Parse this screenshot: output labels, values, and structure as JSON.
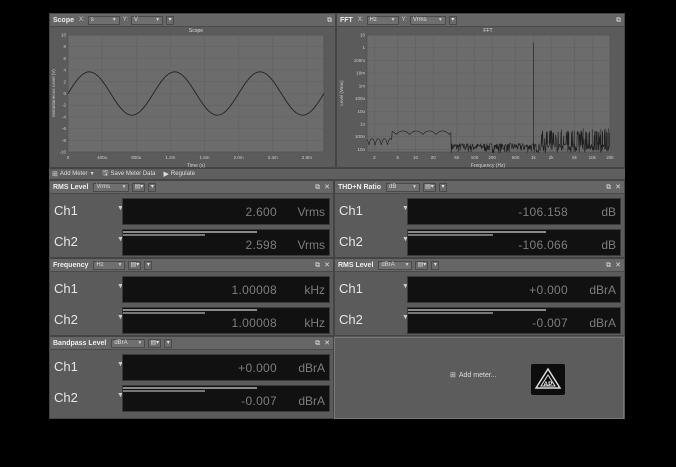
{
  "scope": {
    "title": "Scope",
    "x_tag": "X:",
    "x_unit": "s",
    "y_tag": "Y:",
    "y_unit": "V",
    "chart_title": "Scope",
    "chart_data": {
      "type": "line",
      "title": "Scope",
      "xlabel": "Time (s)",
      "ylabel": "Instantaneous Level (V)",
      "xlim": [
        0,
        0.003
      ],
      "ylim": [
        -10,
        10
      ],
      "x_ticks": [
        "0",
        "400u",
        "800u",
        "1.2m",
        "1.6m",
        "2.0m",
        "2.4m",
        "2.8m"
      ],
      "y_ticks": [
        "10",
        "8",
        "6",
        "4",
        "2",
        "0",
        "-2",
        "-4",
        "-6",
        "-8",
        "-10"
      ],
      "series": [
        {
          "frequency_hz": 1000,
          "amplitude": 3.7
        }
      ]
    }
  },
  "fft": {
    "title": "FFT",
    "x_tag": "X:",
    "x_unit": "Hz",
    "y_tag": "Y:",
    "y_unit": "Vrms",
    "chart_title": "FFT",
    "chart_data": {
      "type": "line",
      "title": "FFT",
      "xlabel": "Frequency (Hz)",
      "ylabel": "Level (Vrms)",
      "x_scale": "log",
      "y_scale": "log",
      "x_ticks": [
        "2",
        "5",
        "10",
        "20",
        "50",
        "100",
        "200",
        "500",
        "1k",
        "2k",
        "5k",
        "10k",
        "20k"
      ],
      "y_ticks": [
        "10",
        "1",
        "100m",
        "10m",
        "1m",
        "100u",
        "10u",
        "1u",
        "100n",
        "10n"
      ],
      "peak": {
        "x": 1000,
        "y": 2.6
      }
    }
  },
  "toolbar": {
    "add_meter": "Add Meter",
    "save_meter_data": "Save Meter Data",
    "regulate": "Regulate"
  },
  "meters": {
    "rms": {
      "title": "RMS Level",
      "unit_select": "Vrms",
      "ch1": {
        "label": "Ch1",
        "value": "2.600",
        "unit": "Vrms"
      },
      "ch2": {
        "label": "Ch2",
        "value": "2.598",
        "unit": "Vrms"
      }
    },
    "thdn": {
      "title": "THD+N Ratio",
      "unit_select": "dB",
      "ch1": {
        "label": "Ch1",
        "value": "-106.158",
        "unit": "dB"
      },
      "ch2": {
        "label": "Ch2",
        "value": "-106.066",
        "unit": "dB"
      }
    },
    "freq": {
      "title": "Frequency",
      "unit_select": "Hz",
      "ch1": {
        "label": "Ch1",
        "value": "1.00008",
        "unit": "kHz"
      },
      "ch2": {
        "label": "Ch2",
        "value": "1.00008",
        "unit": "kHz"
      }
    },
    "rms2": {
      "title": "RMS Level",
      "unit_select": "dBrA",
      "ch1": {
        "label": "Ch1",
        "value": "+0.000",
        "unit": "dBrA"
      },
      "ch2": {
        "label": "Ch2",
        "value": "-0.007",
        "unit": "dBrA"
      }
    },
    "bandpass": {
      "title": "Bandpass Level",
      "unit_select": "dBrA",
      "ch1": {
        "label": "Ch1",
        "value": "+0.000",
        "unit": "dBrA"
      },
      "ch2": {
        "label": "Ch2",
        "value": "-0.007",
        "unit": "dBrA"
      }
    }
  },
  "add_meter_panel": {
    "label": "Add meter..."
  },
  "logo": {
    "name": "ap-logo",
    "text": "AP"
  }
}
